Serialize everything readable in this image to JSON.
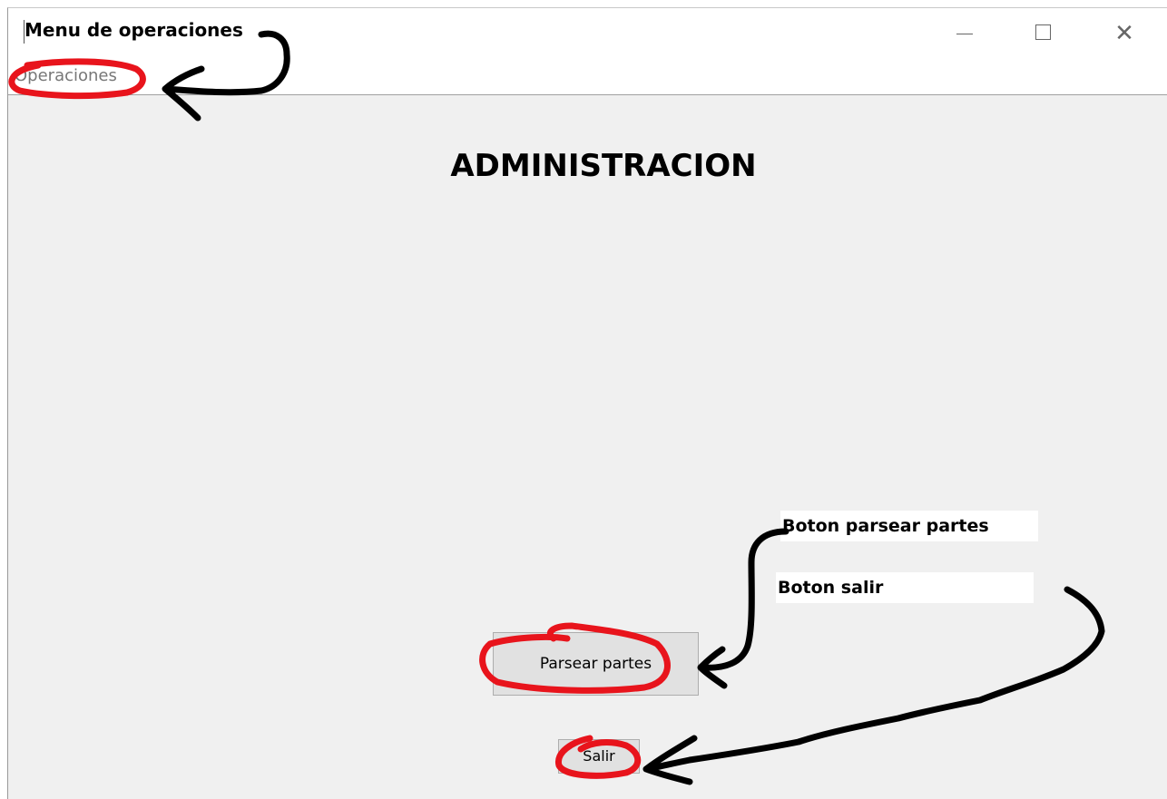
{
  "window": {
    "title": "Menu de operaciones",
    "controls": {
      "minimize": "minimize-icon",
      "maximize": "maximize-icon",
      "close": "close-icon",
      "close_glyph": "✕"
    }
  },
  "menubar": {
    "items": [
      {
        "label": "Operaciones"
      }
    ]
  },
  "main": {
    "heading": "ADMINISTRACION",
    "buttons": {
      "parse_label": "Parsear partes",
      "exit_label": "Salir"
    }
  },
  "annotations": {
    "parse_note": "Boton parsear partes",
    "exit_note": "Boton salir",
    "ink_colors": {
      "red": "#e8141c",
      "black": "#000000"
    }
  }
}
